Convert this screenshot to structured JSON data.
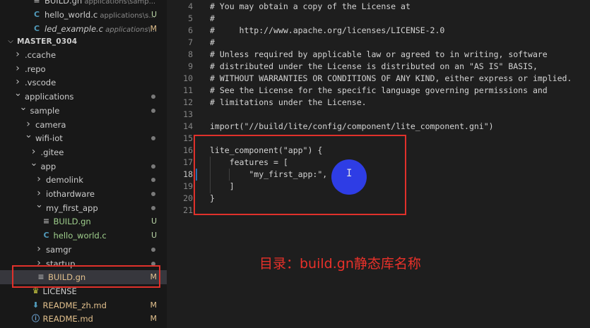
{
  "explorer": {
    "open_editors": [
      {
        "name": "BUILD.gn",
        "path": "applications\\samp...",
        "status": "",
        "icon": "build-gn-icon",
        "italic": false
      },
      {
        "name": "hello_world.c",
        "path": "applications\\s...",
        "status": "U",
        "icon": "c-file-icon",
        "italic": false
      },
      {
        "name": "led_example.c",
        "path": "applications\\...",
        "status": "M",
        "icon": "c-file-icon",
        "italic": true
      }
    ],
    "section_title": "MASTER_0304",
    "tree": [
      {
        "label": ".ccache",
        "depth": 1,
        "chevron": ">",
        "icon": "",
        "status": "",
        "dot": false
      },
      {
        "label": ".repo",
        "depth": 1,
        "chevron": ">",
        "icon": "",
        "status": "",
        "dot": false
      },
      {
        "label": ".vscode",
        "depth": 1,
        "chevron": ">",
        "icon": "",
        "status": "",
        "dot": false
      },
      {
        "label": "applications",
        "depth": 1,
        "chevron": "v",
        "icon": "",
        "status": "",
        "dot": true
      },
      {
        "label": "sample",
        "depth": 2,
        "chevron": "v",
        "icon": "",
        "status": "",
        "dot": true
      },
      {
        "label": "camera",
        "depth": 3,
        "chevron": ">",
        "icon": "",
        "status": "",
        "dot": false
      },
      {
        "label": "wifi-iot",
        "depth": 3,
        "chevron": "v",
        "icon": "",
        "status": "",
        "dot": true
      },
      {
        "label": ".gitee",
        "depth": 4,
        "chevron": ">",
        "icon": "",
        "status": "",
        "dot": false
      },
      {
        "label": "app",
        "depth": 4,
        "chevron": "v",
        "icon": "",
        "status": "",
        "dot": true
      },
      {
        "label": "demolink",
        "depth": 5,
        "chevron": ">",
        "icon": "",
        "status": "",
        "dot": true
      },
      {
        "label": "iothardware",
        "depth": 5,
        "chevron": ">",
        "icon": "",
        "status": "",
        "dot": true
      },
      {
        "label": "my_first_app",
        "depth": 5,
        "chevron": "v",
        "icon": "",
        "status": "",
        "dot": true
      },
      {
        "label": "BUILD.gn",
        "depth": 6,
        "chevron": "",
        "icon": "build-gn-icon",
        "status": "U",
        "dot": false
      },
      {
        "label": "hello_world.c",
        "depth": 6,
        "chevron": "",
        "icon": "c-file-icon",
        "status": "U",
        "dot": false
      },
      {
        "label": "samgr",
        "depth": 5,
        "chevron": ">",
        "icon": "",
        "status": "",
        "dot": true
      },
      {
        "label": "startup",
        "depth": 5,
        "chevron": ">",
        "icon": "",
        "status": "",
        "dot": true
      },
      {
        "label": "BUILD.gn",
        "depth": 5,
        "chevron": "",
        "icon": "build-gn-icon",
        "status": "M",
        "dot": false,
        "selected": true
      },
      {
        "label": "LICENSE",
        "depth": 4,
        "chevron": "",
        "icon": "license-icon",
        "status": "",
        "dot": false
      },
      {
        "label": "README_zh.md",
        "depth": 4,
        "chevron": "",
        "icon": "download-md-icon",
        "status": "M",
        "dot": false
      },
      {
        "label": "README.md",
        "depth": 4,
        "chevron": "",
        "icon": "info-md-icon",
        "status": "M",
        "dot": false
      }
    ]
  },
  "editor": {
    "lines": [
      {
        "n": "4",
        "text": "# You may obtain a copy of the License at"
      },
      {
        "n": "5",
        "text": "#"
      },
      {
        "n": "6",
        "text": "#     http://www.apache.org/licenses/LICENSE-2.0"
      },
      {
        "n": "7",
        "text": "#"
      },
      {
        "n": "8",
        "text": "# Unless required by applicable law or agreed to in writing, software"
      },
      {
        "n": "9",
        "text": "# distributed under the License is distributed on an \"AS IS\" BASIS,"
      },
      {
        "n": "10",
        "text": "# WITHOUT WARRANTIES OR CONDITIONS OF ANY KIND, either express or implied."
      },
      {
        "n": "11",
        "text": "# See the License for the specific language governing permissions and"
      },
      {
        "n": "12",
        "text": "# limitations under the License."
      },
      {
        "n": "13",
        "text": ""
      },
      {
        "n": "14",
        "text": "import(\"//build/lite/config/component/lite_component.gni\")"
      },
      {
        "n": "15",
        "text": ""
      },
      {
        "n": "16",
        "text": "lite_component(\"app\") {"
      },
      {
        "n": "17",
        "text": "    features = ["
      },
      {
        "n": "18",
        "text": "        \"my_first_app:\","
      },
      {
        "n": "19",
        "text": "    ]"
      },
      {
        "n": "20",
        "text": "}"
      },
      {
        "n": "21",
        "text": ""
      }
    ],
    "active_line": "18"
  },
  "annotation": {
    "caption": "目录：build.gn静态库名称",
    "color": "#e8312a"
  },
  "colors": {
    "sidebar_bg": "#181818",
    "editor_bg": "#1e1e1e",
    "highlight_red": "#e0312b",
    "pointer_blue": "#2f3ff0"
  }
}
